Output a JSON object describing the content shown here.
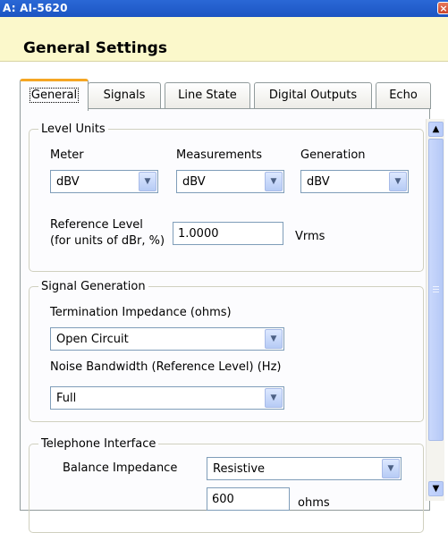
{
  "window": {
    "title": "A: AI-5620",
    "close_glyph": "×"
  },
  "header": {
    "title": "General Settings"
  },
  "tabs": [
    "General",
    "Signals",
    "Line State",
    "Digital Outputs",
    "Echo"
  ],
  "level_units": {
    "legend": "Level Units",
    "meter": {
      "label": "Meter",
      "value": "dBV"
    },
    "measurements": {
      "label": "Measurements",
      "value": "dBV"
    },
    "generation": {
      "label": "Generation",
      "value": "dBV"
    },
    "reference_level": {
      "label_line1": "Reference Level",
      "label_line2": "(for units of dBr, %)",
      "value": "1.0000",
      "unit": "Vrms"
    }
  },
  "signal_generation": {
    "legend": "Signal Generation",
    "termination": {
      "label": "Termination Impedance (ohms)",
      "value": "Open Circuit"
    },
    "noise_bandwidth": {
      "label": "Noise Bandwidth (Reference Level) (Hz)",
      "value": "Full"
    }
  },
  "telephone_interface": {
    "legend": "Telephone Interface",
    "balance": {
      "label": "Balance Impedance",
      "value": "Resistive"
    },
    "resistance": {
      "value": "600",
      "unit": "ohms"
    }
  },
  "icons": {
    "dropdown": "chevron-down-icon",
    "scroll_up": "scroll-up-icon",
    "scroll_down": "scroll-down-icon",
    "close": "close-icon"
  },
  "colors": {
    "titlebar": "#2a68d6",
    "header_bg": "#fbf8cb",
    "tab_highlight": "#f5a623",
    "field_border": "#7f9db9"
  }
}
